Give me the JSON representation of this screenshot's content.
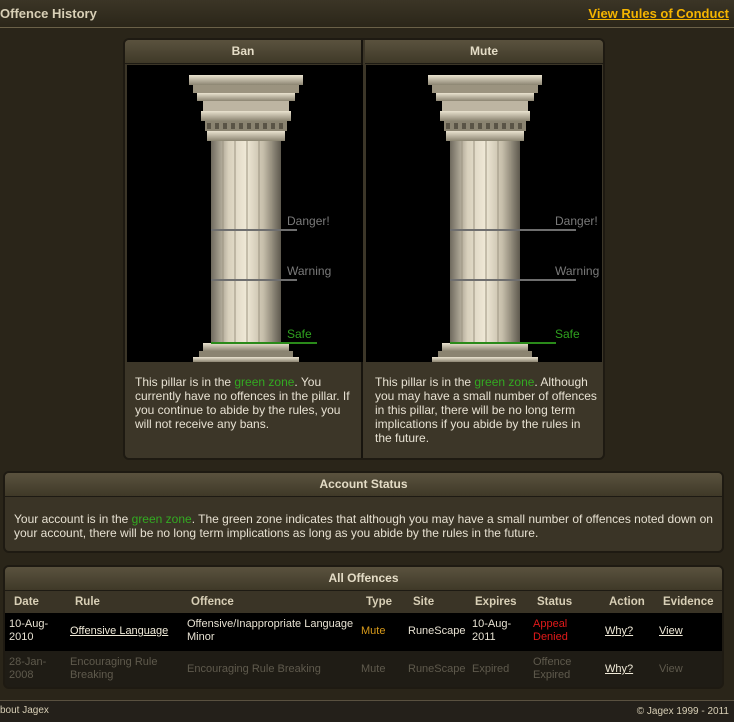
{
  "header": {
    "title": "Offence History",
    "rules_link": "View Rules of Conduct"
  },
  "pillars": [
    {
      "title": "Ban",
      "labels": {
        "danger": "Danger!",
        "warning": "Warning",
        "safe": "Safe"
      },
      "desc_pre": "This pillar is in the ",
      "desc_zone": "green zone",
      "desc_post": ". You currently have no offences in the pillar. If you continue to abide by the rules, you will not receive any bans."
    },
    {
      "title": "Mute",
      "labels": {
        "danger": "Danger!",
        "warning": "Warning",
        "safe": "Safe"
      },
      "desc_pre": "This pillar is in the ",
      "desc_zone": "green zone",
      "desc_post": ". Although you may have a small number of offences in this pillar, there will be no long term implications if you abide by the rules in the future."
    }
  ],
  "account_status": {
    "title": "Account Status",
    "text_pre": "Your account is in the ",
    "text_zone": "green zone",
    "text_post": ". The green zone indicates that although you may have a small number of offences noted down on your account, there will be no long term implications as long as you abide by the rules in the future."
  },
  "offences": {
    "title": "All Offences",
    "columns": [
      "Date",
      "Rule",
      "Offence",
      "Type",
      "Site",
      "Expires",
      "Status",
      "Action",
      "Evidence"
    ],
    "rows": [
      {
        "date_1": "10-Aug-",
        "date_2": "2010",
        "rule_1": "Offensive Language",
        "rule_2": "",
        "offence_1": "Offensive/Inappropriate Language",
        "offence_2": "Minor",
        "type": "Mute",
        "site": "RuneScape",
        "expires_1": "10-Aug-",
        "expires_2": "2011",
        "status_1": "Appeal",
        "status_2": "Denied",
        "action": "Why?",
        "evidence": "View"
      },
      {
        "date_1": "28-Jan-",
        "date_2": "2008",
        "rule_1": "Encouraging Rule",
        "rule_2": "Breaking",
        "offence_1": "Encouraging Rule Breaking",
        "offence_2": "",
        "type": "Mute",
        "site": "RuneScape",
        "expires_1": "Expired",
        "expires_2": "",
        "status_1": "Offence",
        "status_2": "Expired",
        "action": "Why?",
        "evidence": "View"
      }
    ]
  },
  "footer": {
    "about": "bout Jagex",
    "copyright": "© Jagex 1999 - 2011"
  },
  "colors": {
    "accent_link": "#f5b400",
    "green_zone": "#33aa22",
    "appeal_denied": "#e21a1a",
    "mute_type": "#d89a1a"
  },
  "icons": [
    "pillar-column-image"
  ]
}
